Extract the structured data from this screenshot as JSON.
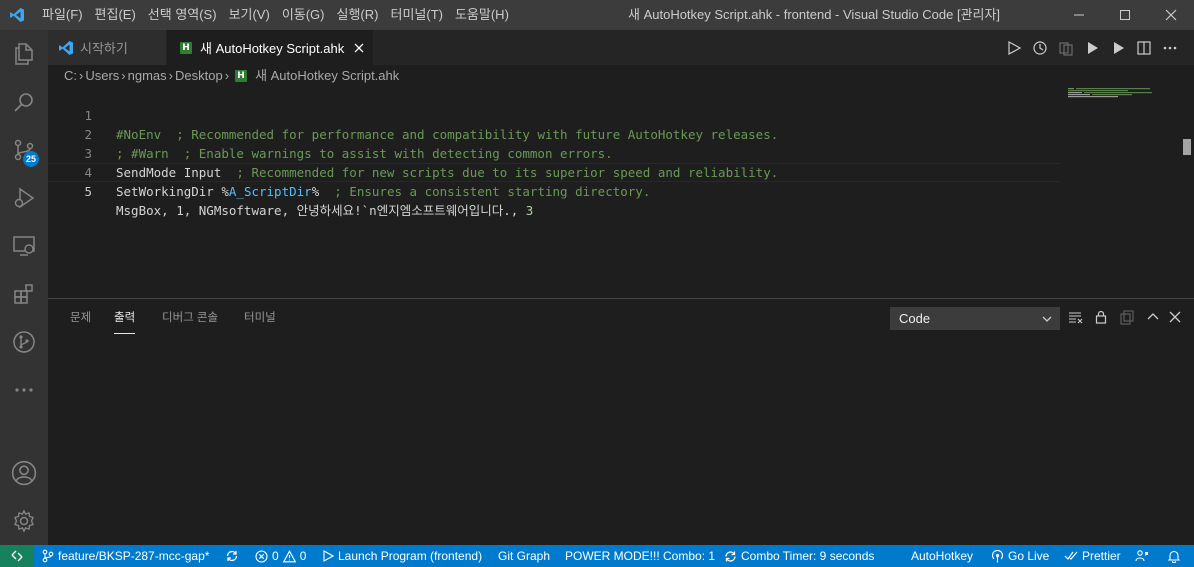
{
  "window": {
    "title": "새 AutoHotkey Script.ahk - frontend - Visual Studio Code [관리자]",
    "menu": [
      "파일(F)",
      "편집(E)",
      "선택 영역(S)",
      "보기(V)",
      "이동(G)",
      "실행(R)",
      "터미널(T)",
      "도움말(H)"
    ]
  },
  "activity_bar": {
    "items": [
      "explorer-icon",
      "search-icon",
      "source-control-icon",
      "run-debug-icon",
      "remote-explorer-icon",
      "extensions-icon",
      "git-graph-icon",
      "more-icon"
    ],
    "source_control_badge": "25",
    "bottom_items": [
      "account-icon",
      "manage-gear-icon"
    ]
  },
  "tabs": [
    {
      "label": "시작하기",
      "active": false
    },
    {
      "label": "새 AutoHotkey Script.ahk",
      "active": true
    }
  ],
  "breadcrumb": {
    "parts": [
      "C:",
      "Users",
      "ngmas",
      "Desktop"
    ],
    "file": "새 AutoHotkey Script.ahk",
    "file_icon_letter": "H"
  },
  "editor": {
    "lines": [
      {
        "num": "1",
        "code": "#NoEnv",
        "comment": "  ; Recommended for performance and compatibility with future AutoHotkey releases."
      },
      {
        "num": "2",
        "code": "",
        "comment": "; #Warn  ; Enable warnings to assist with detecting common errors."
      },
      {
        "num": "3",
        "code": "SendMode Input",
        "comment": "  ; Recommended for new scripts due to its superior speed and reliability."
      },
      {
        "num": "4",
        "code_pre": "SetWorkingDir %",
        "code_var": "A_ScriptDir",
        "code_post": "%",
        "comment": "  ; Ensures a consistent starting directory."
      },
      {
        "num": "5",
        "code": "MsgBox, 1, NGMsoftware, 안녕하세요!`n엔지엠소프트웨어입니다., ",
        "code_num": "3",
        "comment": ""
      }
    ]
  },
  "panel": {
    "tabs": [
      {
        "label": "문제",
        "active": false
      },
      {
        "label": "출력",
        "active": true
      },
      {
        "label": "디버그 콘솔",
        "active": false
      },
      {
        "label": "터미널",
        "active": false
      }
    ],
    "output_channel": "Code"
  },
  "status_bar": {
    "branch": "feature/BKSP-287-mcc-gap*",
    "errors": "0",
    "warnings": "0",
    "launch": "Launch Program (frontend)",
    "git_graph": "Git Graph",
    "power_mode": "POWER MODE!!! Combo: 1",
    "combo_timer": "Combo Timer: 9 seconds",
    "language": "AutoHotkey",
    "go_live": "Go Live",
    "prettier": "Prettier"
  },
  "colors": {
    "accent": "#007acc",
    "remote": "#16825d",
    "comment": "#6a9955",
    "variable": "#4fc1ff",
    "ahk_icon": "#2e7d32"
  }
}
